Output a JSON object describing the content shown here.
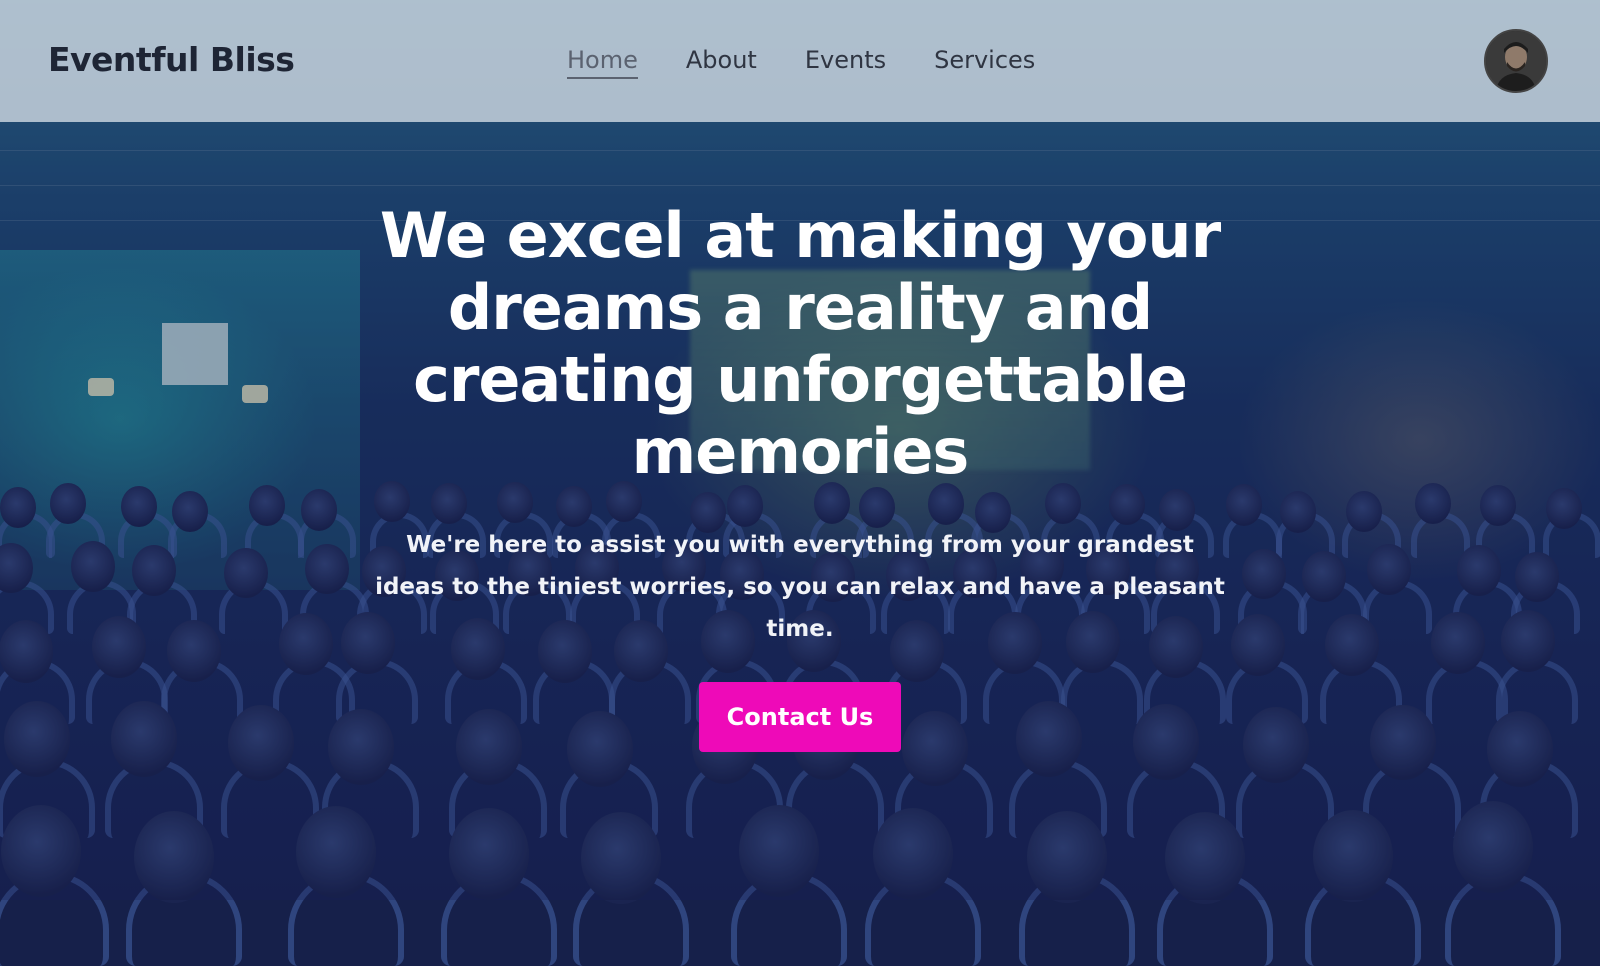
{
  "header": {
    "brand": "Eventful Bliss",
    "nav": [
      {
        "label": "Home",
        "active": true
      },
      {
        "label": "About",
        "active": false
      },
      {
        "label": "Events",
        "active": false
      },
      {
        "label": "Services",
        "active": false
      }
    ],
    "avatar_icon": "user-avatar"
  },
  "hero": {
    "title": "We excel at making your dreams a reality and creating unforgettable memories",
    "subtitle": "We're here to assist you with everything from your grandest ideas to the tiniest worries, so you can relax and have a pleasant time.",
    "cta_label": "Contact Us"
  },
  "colors": {
    "cta": "#ee0ab8",
    "header_bg": "#cdd7e1",
    "brand_text": "#1e2535",
    "hero_text": "#ffffff"
  }
}
